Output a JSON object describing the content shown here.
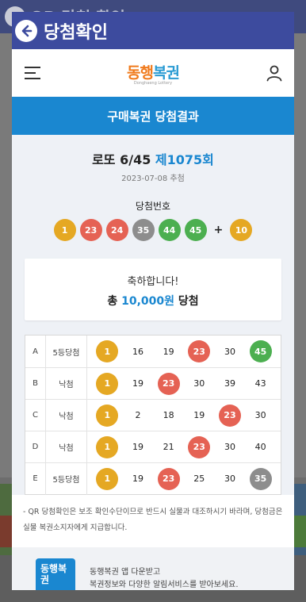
{
  "background": {
    "title": "QR 당첨 확인"
  },
  "dialog": {
    "title": "당첨확인"
  },
  "site": {
    "logo_main": "동행",
    "logo_accent": "복권",
    "logo_sub": "Donghaeng Lottery"
  },
  "section_title": "구매복권 당첨결과",
  "draw": {
    "game": "로또 6/45",
    "round": "제1075회",
    "date": "2023-07-08 추첨",
    "winning_label": "당첨번호",
    "numbers": [
      "1",
      "23",
      "24",
      "35",
      "44",
      "45"
    ],
    "plus": "+",
    "bonus": "10"
  },
  "result": {
    "congrats": "축하합니다!",
    "prefix": "총",
    "amount": "10,000원",
    "suffix": "당첨"
  },
  "ticket": {
    "rows": [
      {
        "letter": "A",
        "status": "5등당첨",
        "nums": [
          "1",
          "16",
          "19",
          "23",
          "30",
          "45"
        ]
      },
      {
        "letter": "B",
        "status": "낙첨",
        "nums": [
          "1",
          "19",
          "23",
          "30",
          "39",
          "43"
        ]
      },
      {
        "letter": "C",
        "status": "낙첨",
        "nums": [
          "1",
          "2",
          "18",
          "19",
          "23",
          "30"
        ]
      },
      {
        "letter": "D",
        "status": "낙첨",
        "nums": [
          "1",
          "19",
          "21",
          "23",
          "30",
          "40"
        ]
      },
      {
        "letter": "E",
        "status": "5등당첨",
        "nums": [
          "1",
          "19",
          "23",
          "25",
          "30",
          "35"
        ]
      }
    ]
  },
  "notice": "- QR 당첨확인은 보조 확인수단이므로 반드시 실물과 대조하시기 바라며, 당첨금은 실물 복권소지자에게 지급합니다.",
  "promo": {
    "icon_text": "동행복권",
    "line1": "동행복권 앱 다운받고",
    "line2": "복권정보와 다양한 알림서비스를 받아보세요."
  },
  "ball_colors": {
    "1": "#e5a823",
    "10": "#e5a823",
    "16": "#e5a823",
    "19": "#e5a823",
    "23": "#e56254",
    "24": "#e56254",
    "35": "#8d8d8d",
    "44": "#4caf50",
    "45": "#4caf50"
  },
  "hit_numbers": [
    "1",
    "23",
    "24",
    "35",
    "44",
    "45"
  ]
}
